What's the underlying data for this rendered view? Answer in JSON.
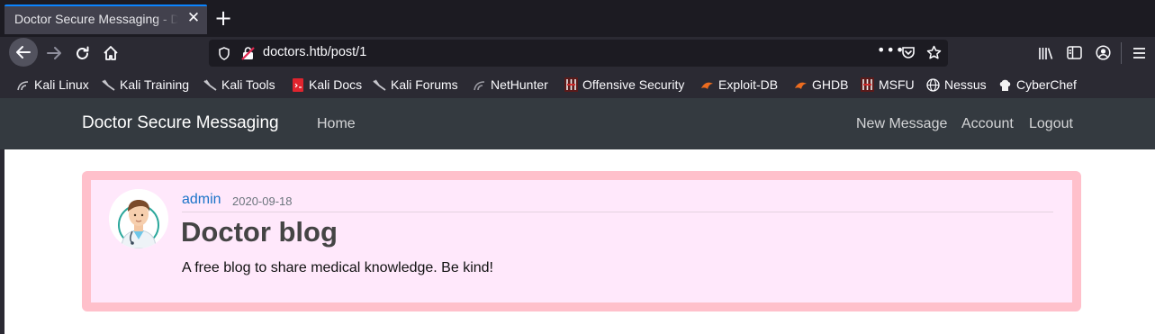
{
  "browser": {
    "tab_title": "Doctor Secure Messaging - Doctor Secure Messaging",
    "tab_close": "✕",
    "new_tab": "+",
    "url": "doctors.htb/post/1",
    "url_actions": "•••"
  },
  "bookmarks": [
    {
      "label": "Kali Linux",
      "icon": "kali-dragon-icon"
    },
    {
      "label": "Kali Training",
      "icon": "kali-dragon-icon"
    },
    {
      "label": "Kali Tools",
      "icon": "kali-dragon-icon"
    },
    {
      "label": "Kali Docs",
      "icon": "kali-docs-icon"
    },
    {
      "label": "Kali Forums",
      "icon": "kali-dragon-icon"
    },
    {
      "label": "NetHunter",
      "icon": "nethunter-icon"
    },
    {
      "label": "Offensive Security",
      "icon": "offsec-icon"
    },
    {
      "label": "Exploit-DB",
      "icon": "exploit-db-icon"
    },
    {
      "label": "GHDB",
      "icon": "ghdb-icon"
    },
    {
      "label": "MSFU",
      "icon": "msfu-icon"
    },
    {
      "label": "Nessus",
      "icon": "globe-icon"
    },
    {
      "label": "CyberChef",
      "icon": "cyberchef-icon"
    }
  ],
  "site": {
    "brand": "Doctor Secure Messaging",
    "nav_left": [
      "Home"
    ],
    "nav_right": [
      "New Message",
      "Account",
      "Logout"
    ]
  },
  "post": {
    "author": "admin",
    "date": "2020-09-18",
    "title": "Doctor blog",
    "content": "A free blog to share medical knowledge. Be kind!"
  },
  "colors": {
    "post_border": "#ffc0cb",
    "post_background": "#ffe8fb",
    "site_nav": "#343a40",
    "author_link": "#1a73c8"
  }
}
